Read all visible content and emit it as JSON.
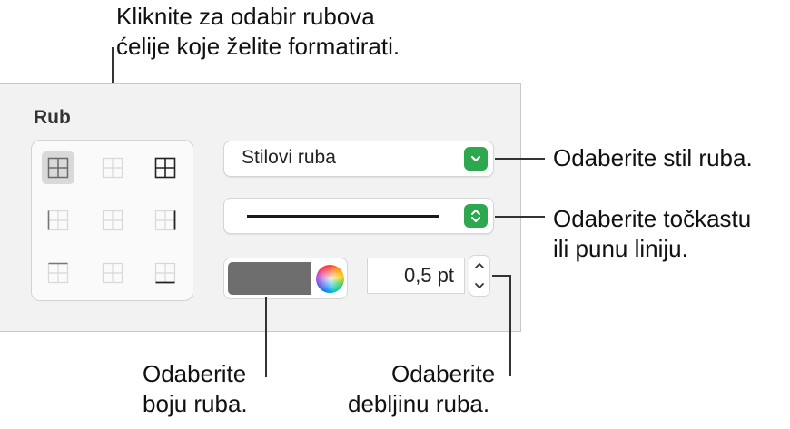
{
  "callouts": {
    "top_line1": "Kliknite za odabir rubova",
    "top_line2": "ćelije koje želite formatirati.",
    "style_hint": "Odaberite stil ruba.",
    "dash_line1": "Odaberite točkastu",
    "dash_line2": "ili punu liniju.",
    "color_line1": "Odaberite",
    "color_line2": "boju ruba.",
    "width_line1": "Odaberite",
    "width_line2": "debljinu ruba."
  },
  "panel": {
    "section_title": "Rub",
    "border_style_label": "Stilovi ruba",
    "line_style": "solid",
    "border_color": "#6e6e6e",
    "width_value": "0,5 pt",
    "accent_color": "#2ea84f"
  },
  "border_options": [
    {
      "icon": "all-borders-icon",
      "selected": true
    },
    {
      "icon": "inside-borders-icon",
      "selected": false
    },
    {
      "icon": "outer-and-inside-borders-icon",
      "selected": false
    },
    {
      "icon": "left-border-icon",
      "selected": false
    },
    {
      "icon": "vertical-inside-border-icon",
      "selected": false
    },
    {
      "icon": "right-border-icon",
      "selected": false
    },
    {
      "icon": "top-border-icon",
      "selected": false
    },
    {
      "icon": "horizontal-inside-border-icon",
      "selected": false
    },
    {
      "icon": "bottom-border-icon",
      "selected": false
    }
  ]
}
